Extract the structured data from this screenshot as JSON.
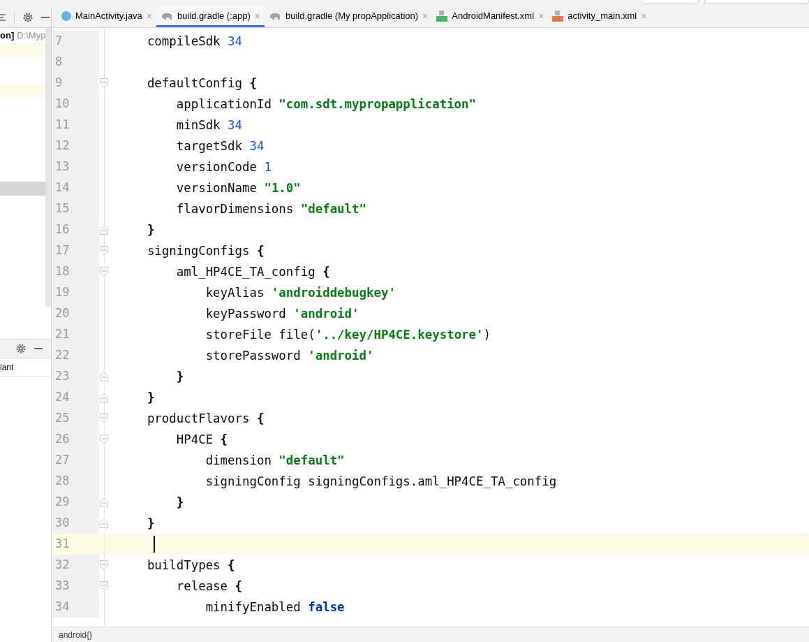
{
  "project_panel": {
    "header_bold": "on]",
    "header_path": "D:\\Myp",
    "rows": [
      {
        "selected": false
      },
      {
        "selected": false
      },
      {
        "selected": true
      }
    ]
  },
  "build_variants_panel": {
    "column_label": "iant"
  },
  "tabs": [
    {
      "label": "MainActivity.java",
      "kind": "class",
      "close": "×",
      "selected": false
    },
    {
      "label": "build.gradle (:app)",
      "kind": "gradle",
      "close": "×",
      "selected": true
    },
    {
      "label": "build.gradle (My propApplication)",
      "kind": "gradle",
      "close": "×",
      "selected": false
    },
    {
      "label": "AndroidManifest.xml",
      "kind": "manifest",
      "close": "×",
      "selected": false
    },
    {
      "label": "activity_main.xml",
      "kind": "layout",
      "close": "×",
      "selected": false
    }
  ],
  "editor": {
    "lines": [
      {
        "number": "7",
        "fold_start": false,
        "fold_end": false,
        "current": false,
        "tokens": [
          {
            "kind": "plain",
            "text": "    compileSdk "
          },
          {
            "kind": "number",
            "text": "34"
          }
        ]
      },
      {
        "number": "8",
        "fold_start": false,
        "fold_end": false,
        "current": false
      },
      {
        "number": "9",
        "fold_start": true,
        "fold_end": false,
        "current": false,
        "tokens": [
          {
            "kind": "plain",
            "text": "    defaultConfig "
          },
          {
            "kind": "brace",
            "text": "{"
          }
        ]
      },
      {
        "number": "10",
        "fold_start": false,
        "fold_end": false,
        "current": false,
        "tokens": [
          {
            "kind": "plain",
            "text": "        applicationId "
          },
          {
            "kind": "string",
            "text": "\"com.sdt.mypropapplication\""
          }
        ]
      },
      {
        "number": "11",
        "fold_start": false,
        "fold_end": false,
        "current": false,
        "tokens": [
          {
            "kind": "plain",
            "text": "        minSdk "
          },
          {
            "kind": "number",
            "text": "34"
          }
        ]
      },
      {
        "number": "12",
        "fold_start": false,
        "fold_end": false,
        "current": false,
        "tokens": [
          {
            "kind": "plain",
            "text": "        targetSdk "
          },
          {
            "kind": "number",
            "text": "34"
          }
        ]
      },
      {
        "number": "13",
        "fold_start": false,
        "fold_end": false,
        "current": false,
        "tokens": [
          {
            "kind": "plain",
            "text": "        versionCode "
          },
          {
            "kind": "number",
            "text": "1"
          }
        ]
      },
      {
        "number": "14",
        "fold_start": false,
        "fold_end": false,
        "current": false,
        "tokens": [
          {
            "kind": "plain",
            "text": "        versionName "
          },
          {
            "kind": "string",
            "text": "\"1.0\""
          }
        ]
      },
      {
        "number": "15",
        "fold_start": false,
        "fold_end": false,
        "current": false,
        "tokens": [
          {
            "kind": "plain",
            "text": "        flavorDimensions "
          },
          {
            "kind": "string",
            "text": "\"default\""
          }
        ]
      },
      {
        "number": "16",
        "fold_start": false,
        "fold_end": true,
        "current": false,
        "tokens": [
          {
            "kind": "brace",
            "text": "    }"
          }
        ]
      },
      {
        "number": "17",
        "fold_start": true,
        "fold_end": false,
        "current": false,
        "tokens": [
          {
            "kind": "plain",
            "text": "    signingConfigs "
          },
          {
            "kind": "brace",
            "text": "{"
          }
        ]
      },
      {
        "number": "18",
        "fold_start": true,
        "fold_end": false,
        "current": false,
        "tokens": [
          {
            "kind": "plain",
            "text": "        aml_HP4CE_TA_config "
          },
          {
            "kind": "brace",
            "text": "{"
          }
        ]
      },
      {
        "number": "19",
        "fold_start": false,
        "fold_end": false,
        "current": false,
        "tokens": [
          {
            "kind": "plain",
            "text": "            keyAlias "
          },
          {
            "kind": "string",
            "text": "'androiddebugkey'"
          }
        ]
      },
      {
        "number": "20",
        "fold_start": false,
        "fold_end": false,
        "current": false,
        "tokens": [
          {
            "kind": "plain",
            "text": "            keyPassword "
          },
          {
            "kind": "string",
            "text": "'android'"
          }
        ]
      },
      {
        "number": "21",
        "fold_start": false,
        "fold_end": false,
        "current": false,
        "tokens": [
          {
            "kind": "plain",
            "text": "            storeFile file("
          },
          {
            "kind": "string",
            "text": "'../key/HP4CE.keystore'"
          },
          {
            "kind": "plain",
            "text": ")"
          }
        ]
      },
      {
        "number": "22",
        "fold_start": false,
        "fold_end": false,
        "current": false,
        "tokens": [
          {
            "kind": "plain",
            "text": "            storePassword "
          },
          {
            "kind": "string",
            "text": "'android'"
          }
        ]
      },
      {
        "number": "23",
        "fold_start": false,
        "fold_end": true,
        "current": false,
        "tokens": [
          {
            "kind": "brace",
            "text": "        }"
          }
        ]
      },
      {
        "number": "24",
        "fold_start": false,
        "fold_end": true,
        "current": false,
        "tokens": [
          {
            "kind": "brace",
            "text": "    }"
          }
        ]
      },
      {
        "number": "25",
        "fold_start": true,
        "fold_end": false,
        "current": false,
        "tokens": [
          {
            "kind": "plain",
            "text": "    productFlavors "
          },
          {
            "kind": "brace",
            "text": "{"
          }
        ]
      },
      {
        "number": "26",
        "fold_start": true,
        "fold_end": false,
        "current": false,
        "tokens": [
          {
            "kind": "plain",
            "text": "        HP4CE "
          },
          {
            "kind": "brace",
            "text": "{"
          }
        ]
      },
      {
        "number": "27",
        "fold_start": false,
        "fold_end": false,
        "current": false,
        "tokens": [
          {
            "kind": "plain",
            "text": "            dimension "
          },
          {
            "kind": "string",
            "text": "\"default\""
          }
        ]
      },
      {
        "number": "28",
        "fold_start": false,
        "fold_end": false,
        "current": false,
        "tokens": [
          {
            "kind": "plain",
            "text": "            signingConfig signingConfigs.aml_HP4CE_TA_config"
          }
        ]
      },
      {
        "number": "29",
        "fold_start": false,
        "fold_end": true,
        "current": false,
        "tokens": [
          {
            "kind": "brace",
            "text": "        }"
          }
        ]
      },
      {
        "number": "30",
        "fold_start": false,
        "fold_end": true,
        "current": false,
        "tokens": [
          {
            "kind": "brace",
            "text": "    }"
          }
        ]
      },
      {
        "number": "31",
        "fold_start": false,
        "fold_end": false,
        "current": true
      },
      {
        "number": "32",
        "fold_start": true,
        "fold_end": false,
        "current": false,
        "tokens": [
          {
            "kind": "plain",
            "text": "    buildTypes "
          },
          {
            "kind": "brace",
            "text": "{"
          }
        ]
      },
      {
        "number": "33",
        "fold_start": true,
        "fold_end": false,
        "current": false,
        "tokens": [
          {
            "kind": "plain",
            "text": "        release "
          },
          {
            "kind": "brace",
            "text": "{"
          }
        ]
      },
      {
        "number": "34",
        "fold_start": false,
        "fold_end": false,
        "current": false,
        "tokens": [
          {
            "kind": "plain",
            "text": "            minifyEnabled "
          },
          {
            "kind": "keyword",
            "text": "false"
          }
        ]
      }
    ]
  },
  "breadcrumb": "android{}"
}
